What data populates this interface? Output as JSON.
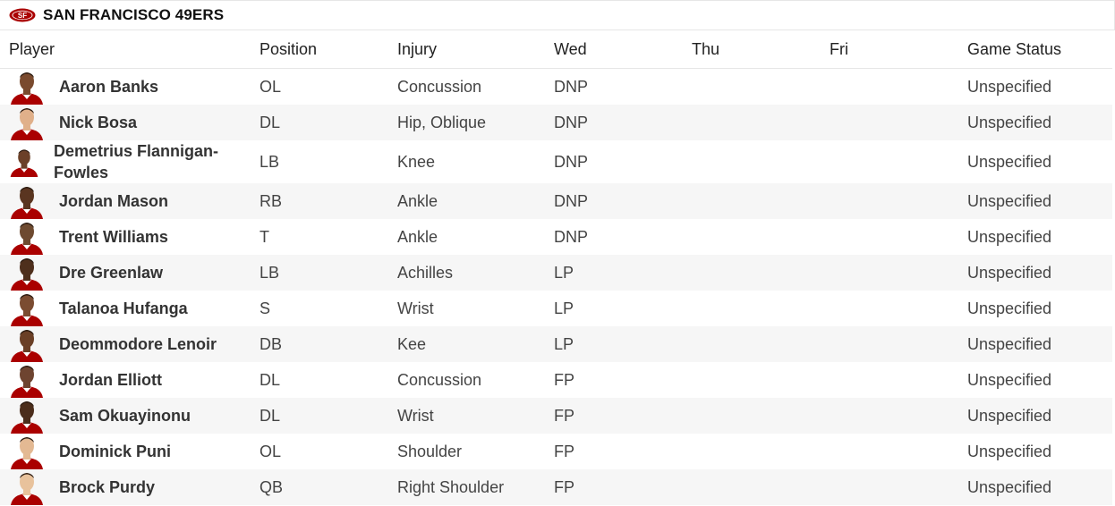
{
  "team": {
    "name": "SAN FRANCISCO 49ERS",
    "logo_icon": "49ers-logo-icon"
  },
  "columns": {
    "player": "Player",
    "position": "Position",
    "injury": "Injury",
    "wed": "Wed",
    "thu": "Thu",
    "fri": "Fri",
    "game_status": "Game Status"
  },
  "rows": [
    {
      "player": "Aaron Banks",
      "position": "OL",
      "injury": "Concussion",
      "wed": "DNP",
      "thu": "",
      "fri": "",
      "game_status": "Unspecified"
    },
    {
      "player": "Nick Bosa",
      "position": "DL",
      "injury": "Hip, Oblique",
      "wed": "DNP",
      "thu": "",
      "fri": "",
      "game_status": "Unspecified"
    },
    {
      "player": "Demetrius Flannigan-Fowles",
      "position": "LB",
      "injury": "Knee",
      "wed": "DNP",
      "thu": "",
      "fri": "",
      "game_status": "Unspecified"
    },
    {
      "player": "Jordan Mason",
      "position": "RB",
      "injury": "Ankle",
      "wed": "DNP",
      "thu": "",
      "fri": "",
      "game_status": "Unspecified"
    },
    {
      "player": "Trent Williams",
      "position": "T",
      "injury": "Ankle",
      "wed": "DNP",
      "thu": "",
      "fri": "",
      "game_status": "Unspecified"
    },
    {
      "player": "Dre Greenlaw",
      "position": "LB",
      "injury": "Achilles",
      "wed": "LP",
      "thu": "",
      "fri": "",
      "game_status": "Unspecified"
    },
    {
      "player": "Talanoa Hufanga",
      "position": "S",
      "injury": "Wrist",
      "wed": "LP",
      "thu": "",
      "fri": "",
      "game_status": "Unspecified"
    },
    {
      "player": "Deommodore Lenoir",
      "position": "DB",
      "injury": "Kee",
      "wed": "LP",
      "thu": "",
      "fri": "",
      "game_status": "Unspecified"
    },
    {
      "player": "Jordan Elliott",
      "position": "DL",
      "injury": "Concussion",
      "wed": "FP",
      "thu": "",
      "fri": "",
      "game_status": "Unspecified"
    },
    {
      "player": "Sam Okuayinonu",
      "position": "DL",
      "injury": "Wrist",
      "wed": "FP",
      "thu": "",
      "fri": "",
      "game_status": "Unspecified"
    },
    {
      "player": "Dominick Puni",
      "position": "OL",
      "injury": "Shoulder",
      "wed": "FP",
      "thu": "",
      "fri": "",
      "game_status": "Unspecified"
    },
    {
      "player": "Brock Purdy",
      "position": "QB",
      "injury": "Right Shoulder",
      "wed": "FP",
      "thu": "",
      "fri": "",
      "game_status": "Unspecified"
    }
  ],
  "colors": {
    "brand_red": "#aa0000",
    "gold": "#b3995d",
    "row_alt": "#f6f6f6"
  }
}
